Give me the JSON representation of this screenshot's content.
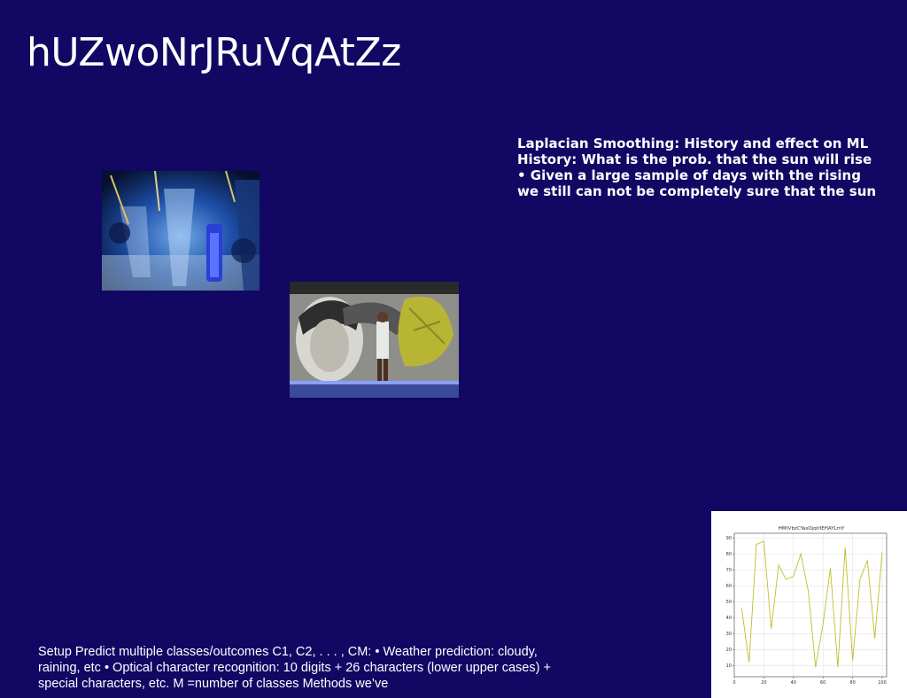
{
  "slide": {
    "title": "hUZwoNrJRuVqAtZz",
    "text_lines": [
      "Laplacian Smoothing: History and effect on ML",
      "History: What is the prob. that the sun will rise",
      "• Given a large sample of days with the rising",
      "we still can not be completely sure that the sun"
    ],
    "bottom_text": "Setup Predict multiple classes/outcomes C1, C2, . . . , CM: • Weather prediction: cloudy, raining, etc • Optical character recognition: 10 digits + 26 characters (lower upper cases) + special characters, etc. M =number of classes Methods we’ve"
  },
  "colors": {
    "background": "#120864",
    "text": "#ffffff",
    "chart_line": "#bfbf2a"
  },
  "chart_data": {
    "type": "line",
    "title": "HMtVbzCYasOjqIrIEHAYLmY",
    "xlabel": "",
    "ylabel": "",
    "x": [
      5,
      10,
      15,
      20,
      25,
      30,
      35,
      40,
      45,
      50,
      55,
      60,
      65,
      70,
      75,
      80,
      85,
      90,
      95,
      100
    ],
    "values": [
      46,
      12,
      86,
      88,
      33,
      73,
      64,
      66,
      80,
      57,
      9,
      36,
      71,
      9,
      84,
      13,
      64,
      76,
      27,
      81
    ],
    "xlim": [
      0,
      103
    ],
    "ylim": [
      3,
      93
    ],
    "xticks": [
      0,
      20,
      40,
      60,
      80,
      100
    ],
    "yticks": [
      10,
      20,
      30,
      40,
      50,
      60,
      70,
      80,
      90
    ],
    "grid": true,
    "line_color": "#bfbf2a"
  }
}
